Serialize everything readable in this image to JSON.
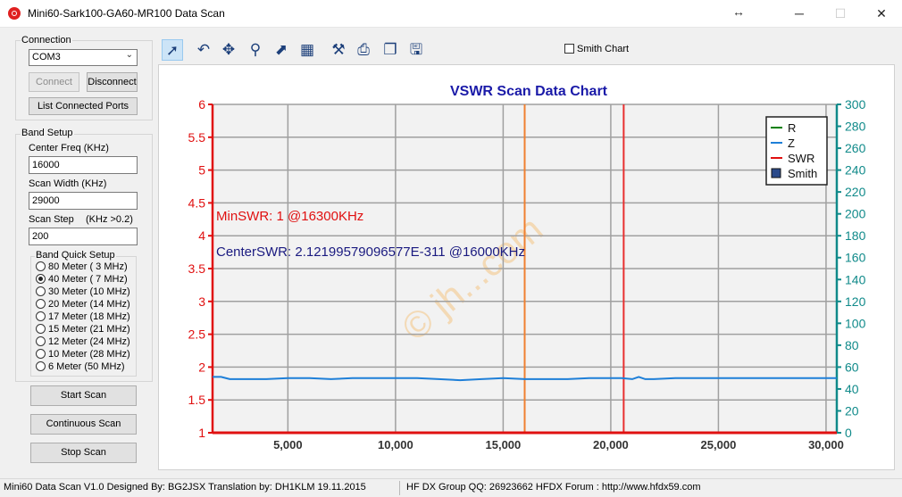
{
  "window": {
    "title": "Mini60-Sark100-GA60-MR100 Data Scan",
    "resize_icon": "double-arrow-icon",
    "minimize": "─",
    "maximize": "☐",
    "close": "✕"
  },
  "connection": {
    "group_label": "Connection",
    "port_value": "COM3",
    "connect_label": "Connect",
    "disconnect_label": "Disconnect",
    "list_ports_label": "List Connected Ports"
  },
  "band_setup": {
    "group_label": "Band Setup",
    "center_freq_label": "Center Freq  (KHz)",
    "center_freq_value": "16000",
    "scan_width_label": "Scan Width   (KHz)",
    "scan_width_value": "29000",
    "scan_step_label": "Scan Step",
    "scan_step_hint": "(KHz >0.2)",
    "scan_step_value": "200",
    "quick_setup_label": "Band Quick Setup",
    "bands": [
      {
        "label": "80 Meter (  3 MHz)",
        "selected": false
      },
      {
        "label": "40 Meter (  7 MHz)",
        "selected": true
      },
      {
        "label": "30 Meter (10 MHz)",
        "selected": false
      },
      {
        "label": "20 Meter (14 MHz)",
        "selected": false
      },
      {
        "label": "17 Meter (18 MHz)",
        "selected": false
      },
      {
        "label": "15 Meter (21 MHz)",
        "selected": false
      },
      {
        "label": "12 Meter (24 MHz)",
        "selected": false
      },
      {
        "label": "10 Meter (28 MHz)",
        "selected": false
      },
      {
        "label": "6 Meter  (50 MHz)",
        "selected": false
      }
    ]
  },
  "actions": {
    "start_scan": "Start Scan",
    "continuous_scan": "Continuous Scan",
    "stop_scan": "Stop Scan"
  },
  "toolbar": {
    "icons": [
      "pointer-icon",
      "undo-icon",
      "move-icon",
      "zoom-icon",
      "export-image-icon",
      "data-table-icon",
      "tools-icon",
      "print-icon",
      "copy-icon",
      "save-icon"
    ],
    "smith_chart_label": "Smith Chart",
    "smith_chart_checked": false
  },
  "chart_data": {
    "type": "line",
    "title": "VSWR Scan Data Chart",
    "x_ticks": [
      "5,000",
      "10,000",
      "15,000",
      "20,000",
      "25,000",
      "30,000"
    ],
    "y_left_ticks": [
      "1",
      "1.5",
      "2",
      "2.5",
      "3",
      "3.5",
      "4",
      "4.5",
      "5",
      "5.5",
      "6"
    ],
    "y_right_ticks": [
      "0",
      "20",
      "40",
      "60",
      "80",
      "100",
      "120",
      "140",
      "160",
      "180",
      "200",
      "220",
      "240",
      "260",
      "280",
      "300"
    ],
    "xlim": [
      1500,
      30500
    ],
    "ylim_left": [
      1,
      6
    ],
    "ylim_right": [
      0,
      300
    ],
    "grid": true,
    "legend_position": "top-right",
    "legend": [
      {
        "name": "R",
        "color": "#008000",
        "kind": "line"
      },
      {
        "name": "Z",
        "color": "#1e7fd8",
        "kind": "line"
      },
      {
        "name": "SWR",
        "color": "#e01010",
        "kind": "line"
      },
      {
        "name": "Smith",
        "color": "#2a4a8a",
        "kind": "box"
      }
    ],
    "annotations": {
      "min_swr": "MinSWR: 1 @16300KHz",
      "center_swr": "CenterSWR: 2.12199579096577E-311 @16000KHz"
    },
    "markers": [
      {
        "x": 16000,
        "color": "#f08030"
      },
      {
        "x": 20600,
        "color": "#e83030"
      }
    ],
    "series": [
      {
        "name": "Z",
        "axis": "right",
        "color": "#1e7fd8",
        "x": [
          1500,
          1900,
          2300,
          3000,
          4000,
          5000,
          6000,
          7000,
          8000,
          9000,
          10000,
          11000,
          12000,
          13000,
          14000,
          15000,
          16000,
          17000,
          18000,
          19000,
          20000,
          20500,
          21000,
          21300,
          21600,
          22000,
          23000,
          24000,
          25000,
          26000,
          27000,
          28000,
          29000,
          30000,
          30500
        ],
        "values": [
          51,
          51,
          49,
          49,
          49,
          50,
          50,
          49,
          50,
          50,
          50,
          50,
          49,
          48,
          49,
          50,
          49,
          49,
          49,
          50,
          50,
          50,
          49,
          51,
          49,
          49,
          50,
          50,
          50,
          50,
          50,
          50,
          50,
          50,
          50
        ]
      },
      {
        "name": "SWR",
        "axis": "left",
        "color": "#e01010",
        "x": [
          1500,
          30500
        ],
        "values": [
          1,
          1
        ]
      }
    ]
  },
  "watermark": "© jh...com",
  "status": {
    "segment1": "Mini60 Data Scan V1.0   Designed By: BG2JSX  Translation by: DH1KLM    19.11.2015",
    "segment2": "HF DX Group QQ: 26923662  HFDX Forum :  http://www.hfdx59.com"
  }
}
